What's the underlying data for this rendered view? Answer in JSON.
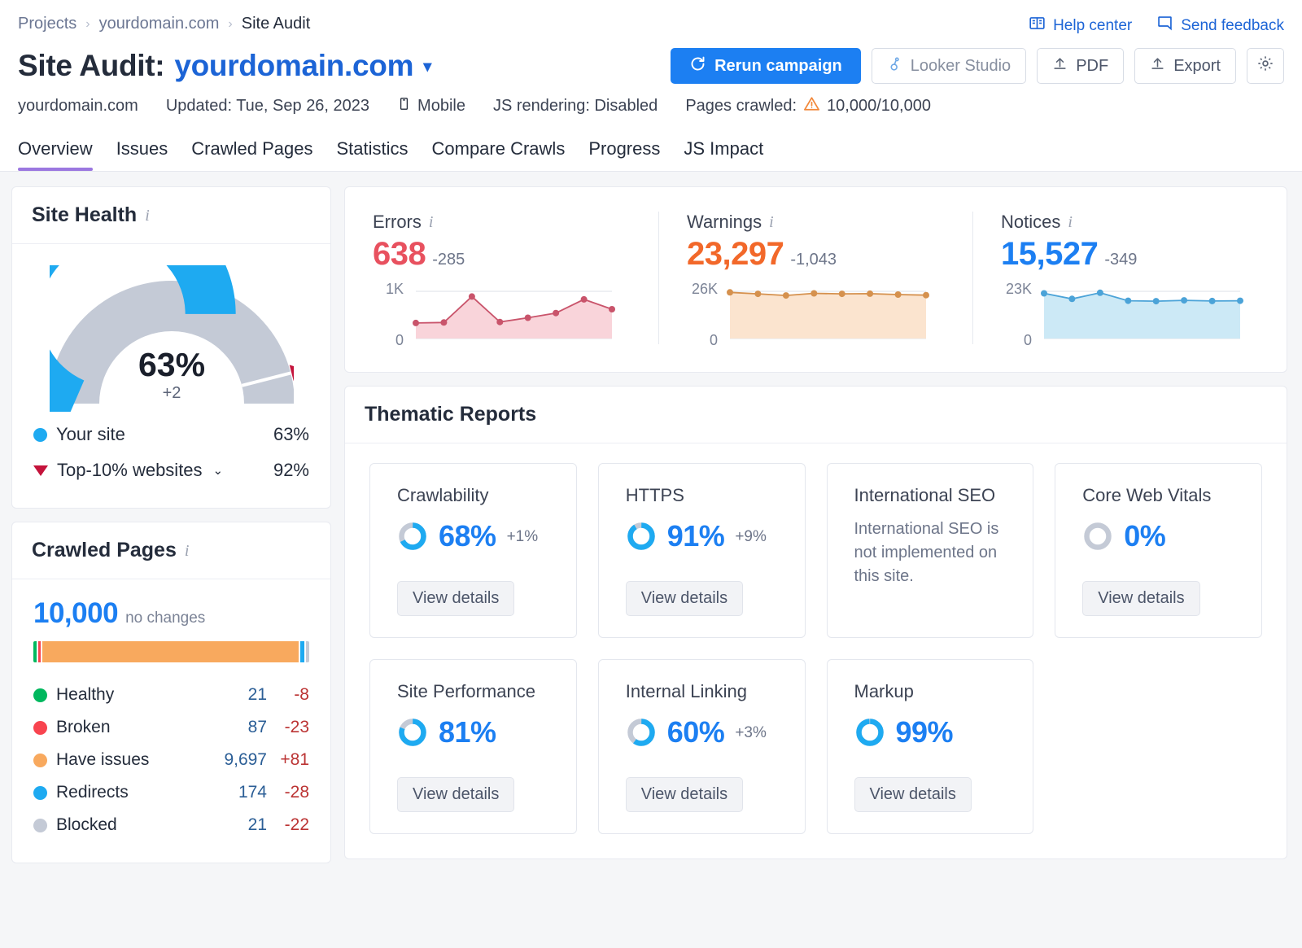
{
  "breadcrumb": [
    {
      "label": "Projects",
      "current": false
    },
    {
      "label": "yourdomain.com",
      "current": false
    },
    {
      "label": "Site Audit",
      "current": true
    }
  ],
  "header": {
    "help_center": "Help center",
    "send_feedback": "Send feedback",
    "title_prefix": "Site Audit:",
    "domain": "yourdomain.com",
    "buttons": {
      "rerun": "Rerun campaign",
      "looker": "Looker Studio",
      "pdf": "PDF",
      "export": "Export",
      "settings": ""
    },
    "meta": {
      "domain": "yourdomain.com",
      "updated": "Updated: Tue, Sep 26, 2023",
      "device": "Mobile",
      "js_rendering": "JS rendering: Disabled",
      "pages_crawled_label": "Pages crawled:",
      "pages_crawled_value": "10,000/10,000"
    }
  },
  "tabs": [
    {
      "label": "Overview",
      "active": true
    },
    {
      "label": "Issues",
      "active": false
    },
    {
      "label": "Crawled Pages",
      "active": false
    },
    {
      "label": "Statistics",
      "active": false
    },
    {
      "label": "Compare Crawls",
      "active": false
    },
    {
      "label": "Progress",
      "active": false
    },
    {
      "label": "JS Impact",
      "active": false
    }
  ],
  "site_health": {
    "title": "Site Health",
    "score": "63%",
    "delta": "+2",
    "legend": [
      {
        "label": "Your site",
        "value": "63%",
        "color": "#1eaaf1",
        "marker": "dot"
      },
      {
        "label": "Top-10% websites",
        "value": "92%",
        "color": "#c4133b",
        "marker": "triangle",
        "has_caret": true
      }
    ]
  },
  "crawled_pages": {
    "title": "Crawled Pages",
    "total": "10,000",
    "total_note": "no changes",
    "rows": [
      {
        "label": "Healthy",
        "value": "21",
        "delta": "-8",
        "color": "#00b85e",
        "share": 0.21
      },
      {
        "label": "Broken",
        "value": "87",
        "delta": "-23",
        "color": "#f8444f",
        "share": 0.87
      },
      {
        "label": "Have issues",
        "value": "9,697",
        "delta": "+81",
        "color": "#f8a95e",
        "share": 96.97
      },
      {
        "label": "Redirects",
        "value": "174",
        "delta": "-28",
        "color": "#1eaaf1",
        "share": 1.74
      },
      {
        "label": "Blocked",
        "value": "21",
        "delta": "-22",
        "color": "#c4cad6",
        "share": 0.21
      }
    ]
  },
  "chart_data": [
    {
      "type": "area",
      "title": "Errors",
      "value": "638",
      "delta": "-285",
      "color": "#c9546b",
      "fill": "#f9d4da",
      "ylabel_top": "1K",
      "ylabel_bottom": "0",
      "ylim": [
        0,
        1000
      ],
      "values": [
        330,
        340,
        890,
        350,
        440,
        540,
        830,
        620
      ]
    },
    {
      "type": "area",
      "title": "Warnings",
      "value": "23,297",
      "delta": "-1,043",
      "color": "#d5914e",
      "fill": "#fbe4cf",
      "ylabel_top": "26K",
      "ylabel_bottom": "0",
      "ylim": [
        0,
        26000
      ],
      "values": [
        25400,
        24600,
        23700,
        24900,
        24600,
        24700,
        24200,
        23900
      ]
    },
    {
      "type": "area",
      "title": "Notices",
      "value": "15,527",
      "delta": "-349",
      "color": "#4ba3d8",
      "fill": "#cce9f6",
      "ylabel_top": "23K",
      "ylabel_bottom": "0",
      "ylim": [
        0,
        23000
      ],
      "values": [
        22000,
        19300,
        22300,
        18400,
        18200,
        18600,
        18300,
        18400
      ]
    }
  ],
  "thematic": {
    "title": "Thematic Reports",
    "view_details": "View details",
    "cards": [
      {
        "name": "Crawlability",
        "pct": "68%",
        "value": 68,
        "delta": "+1%",
        "note": "",
        "has_button": true,
        "has_donut": true
      },
      {
        "name": "HTTPS",
        "pct": "91%",
        "value": 91,
        "delta": "+9%",
        "note": "",
        "has_button": true,
        "has_donut": true
      },
      {
        "name": "International SEO",
        "pct": "",
        "value": null,
        "delta": "",
        "note": "International SEO is not implemented on this site.",
        "has_button": false,
        "has_donut": false
      },
      {
        "name": "Core Web Vitals",
        "pct": "0%",
        "value": 0,
        "delta": "",
        "note": "",
        "has_button": true,
        "has_donut": true
      },
      {
        "name": "Site Performance",
        "pct": "81%",
        "value": 81,
        "delta": "",
        "note": "",
        "has_button": true,
        "has_donut": true
      },
      {
        "name": "Internal Linking",
        "pct": "60%",
        "value": 60,
        "delta": "+3%",
        "note": "",
        "has_button": true,
        "has_donut": true
      },
      {
        "name": "Markup",
        "pct": "99%",
        "value": 99,
        "delta": "",
        "note": "",
        "has_button": true,
        "has_donut": true
      }
    ]
  },
  "colors": {
    "accent_blue": "#1c7ff2",
    "link_blue": "#1c64d6",
    "error_red": "#e8515f",
    "warning_orange": "#f2682a",
    "notice_blue": "#1c7ff2",
    "tab_underline": "#9b77e0"
  }
}
